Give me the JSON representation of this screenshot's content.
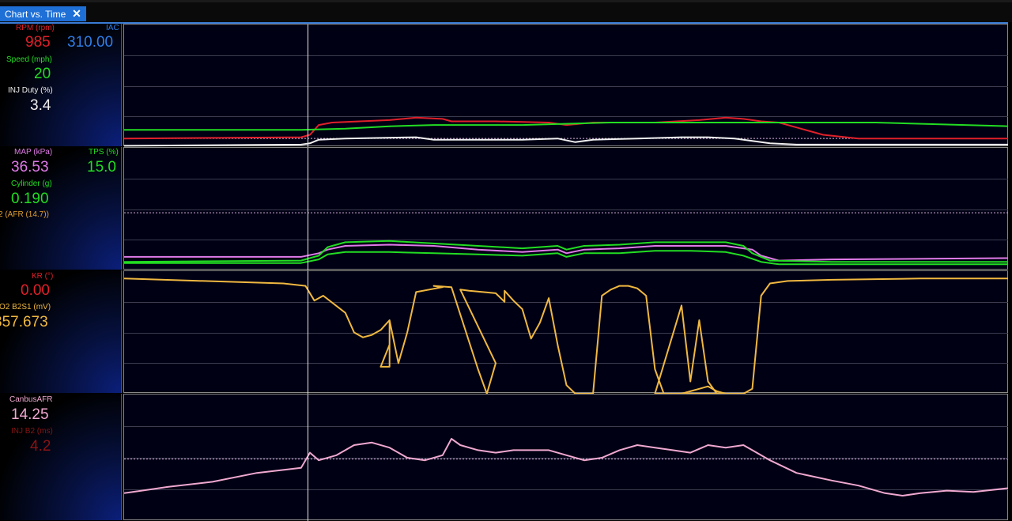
{
  "tab": {
    "title": "Chart vs. Time",
    "close": "✕"
  },
  "cursor_fraction": 0.207,
  "panels": [
    {
      "params": [
        {
          "label": "RPM (rpm)",
          "value": "985",
          "color": "#e0202a"
        },
        {
          "label": "IAC",
          "value": "310.00",
          "color": "#2f7fe8"
        },
        {
          "label": "Speed (mph)",
          "value": "20",
          "color": "#22dd22"
        },
        {
          "label": "INJ Duty (%)",
          "value": "3.4",
          "color": "#f0f0f0"
        }
      ]
    },
    {
      "params": [
        {
          "label": "MAP (kPa)",
          "value": "36.53",
          "color": "#e07ae8"
        },
        {
          "label": "TPS (%)",
          "value": "15.0",
          "color": "#22dd22"
        },
        {
          "label": "Cylinder (g)",
          "value": "0.190",
          "color": "#22dd22"
        },
        {
          "label": "2 (AFR (14.7))",
          "value": "",
          "color": "#e0a030"
        }
      ]
    },
    {
      "params": [
        {
          "label": "KR (°)",
          "value": "0.00",
          "color": "#e0202a"
        },
        {
          "label": "O2 B2S1 (mV)",
          "value": "357.673",
          "color": "#f0b840"
        }
      ]
    },
    {
      "params": [
        {
          "label": "CanbusAFR",
          "value": "14.25",
          "color": "#f0a8d0"
        },
        {
          "label": "INJ B2 (ms)",
          "value": "4.2",
          "color": "#8a1414"
        }
      ]
    }
  ],
  "chart_data": [
    {
      "type": "line",
      "series": [
        {
          "name": "RPM (rpm)",
          "color": "#e0202a",
          "points": [
            [
              0,
              0.93
            ],
            [
              0.2,
              0.92
            ],
            [
              0.21,
              0.9
            ],
            [
              0.22,
              0.82
            ],
            [
              0.235,
              0.8
            ],
            [
              0.3,
              0.78
            ],
            [
              0.33,
              0.76
            ],
            [
              0.36,
              0.77
            ],
            [
              0.37,
              0.79
            ],
            [
              0.42,
              0.79
            ],
            [
              0.48,
              0.8
            ],
            [
              0.5,
              0.82
            ],
            [
              0.53,
              0.8
            ],
            [
              0.6,
              0.8
            ],
            [
              0.65,
              0.78
            ],
            [
              0.68,
              0.76
            ],
            [
              0.7,
              0.77
            ],
            [
              0.72,
              0.79
            ],
            [
              0.74,
              0.8
            ],
            [
              0.76,
              0.84
            ],
            [
              0.79,
              0.9
            ],
            [
              0.83,
              0.93
            ],
            [
              1,
              0.93
            ]
          ]
        },
        {
          "name": "Speed (mph)",
          "color": "#22dd22",
          "points": [
            [
              0,
              0.86
            ],
            [
              0.2,
              0.86
            ],
            [
              0.25,
              0.85
            ],
            [
              0.3,
              0.83
            ],
            [
              0.35,
              0.82
            ],
            [
              0.45,
              0.82
            ],
            [
              0.55,
              0.8
            ],
            [
              0.65,
              0.8
            ],
            [
              0.7,
              0.8
            ],
            [
              0.85,
              0.8
            ],
            [
              1,
              0.83
            ]
          ]
        },
        {
          "name": "INJ Duty (%)",
          "color": "#f0f0f0",
          "points": [
            [
              0,
              0.99
            ],
            [
              0.2,
              0.98
            ],
            [
              0.21,
              0.97
            ],
            [
              0.22,
              0.94
            ],
            [
              0.25,
              0.93
            ],
            [
              0.33,
              0.92
            ],
            [
              0.35,
              0.94
            ],
            [
              0.45,
              0.94
            ],
            [
              0.49,
              0.93
            ],
            [
              0.51,
              0.96
            ],
            [
              0.53,
              0.94
            ],
            [
              0.58,
              0.93
            ],
            [
              0.63,
              0.92
            ],
            [
              0.66,
              0.92
            ],
            [
              0.69,
              0.93
            ],
            [
              0.71,
              0.95
            ],
            [
              0.73,
              0.97
            ],
            [
              0.76,
              0.98
            ],
            [
              1,
              0.98
            ]
          ]
        }
      ],
      "reference_line": 0.93
    },
    {
      "type": "line",
      "series": [
        {
          "name": "MAP (kPa)",
          "color": "#e07ae8",
          "points": [
            [
              0,
              0.89
            ],
            [
              0.2,
              0.89
            ],
            [
              0.22,
              0.86
            ],
            [
              0.23,
              0.83
            ],
            [
              0.25,
              0.8
            ],
            [
              0.3,
              0.79
            ],
            [
              0.35,
              0.8
            ],
            [
              0.4,
              0.83
            ],
            [
              0.45,
              0.85
            ],
            [
              0.49,
              0.83
            ],
            [
              0.5,
              0.86
            ],
            [
              0.52,
              0.83
            ],
            [
              0.56,
              0.82
            ],
            [
              0.6,
              0.8
            ],
            [
              0.64,
              0.8
            ],
            [
              0.68,
              0.8
            ],
            [
              0.71,
              0.83
            ],
            [
              0.72,
              0.88
            ],
            [
              0.74,
              0.92
            ],
            [
              0.8,
              0.91
            ],
            [
              1,
              0.9
            ]
          ]
        },
        {
          "name": "TPS (%)",
          "color": "#22dd22",
          "points": [
            [
              0,
              0.93
            ],
            [
              0.2,
              0.92
            ],
            [
              0.22,
              0.88
            ],
            [
              0.23,
              0.81
            ],
            [
              0.25,
              0.77
            ],
            [
              0.3,
              0.76
            ],
            [
              0.35,
              0.78
            ],
            [
              0.4,
              0.8
            ],
            [
              0.45,
              0.82
            ],
            [
              0.49,
              0.8
            ],
            [
              0.5,
              0.83
            ],
            [
              0.52,
              0.8
            ],
            [
              0.56,
              0.79
            ],
            [
              0.6,
              0.77
            ],
            [
              0.64,
              0.77
            ],
            [
              0.68,
              0.77
            ],
            [
              0.7,
              0.8
            ],
            [
              0.71,
              0.86
            ],
            [
              0.73,
              0.92
            ],
            [
              0.8,
              0.93
            ],
            [
              1,
              0.93
            ]
          ]
        },
        {
          "name": "Cylinder (g)",
          "color": "#22dd22",
          "points": [
            [
              0,
              0.94
            ],
            [
              0.2,
              0.94
            ],
            [
              0.22,
              0.91
            ],
            [
              0.23,
              0.87
            ],
            [
              0.25,
              0.85
            ],
            [
              0.3,
              0.85
            ],
            [
              0.35,
              0.86
            ],
            [
              0.4,
              0.87
            ],
            [
              0.45,
              0.88
            ],
            [
              0.49,
              0.86
            ],
            [
              0.5,
              0.89
            ],
            [
              0.52,
              0.86
            ],
            [
              0.56,
              0.86
            ],
            [
              0.6,
              0.84
            ],
            [
              0.64,
              0.84
            ],
            [
              0.68,
              0.85
            ],
            [
              0.7,
              0.88
            ],
            [
              0.72,
              0.93
            ],
            [
              0.74,
              0.95
            ],
            [
              1,
              0.95
            ]
          ]
        }
      ],
      "reference_line": 0.53
    },
    {
      "type": "line",
      "series": [
        {
          "name": "O2 B2S1 (mV)",
          "color": "#f0b840",
          "points": [
            [
              0,
              0.06
            ],
            [
              0.18,
              0.1
            ],
            [
              0.205,
              0.12
            ],
            [
              0.215,
              0.24
            ],
            [
              0.225,
              0.2
            ],
            [
              0.25,
              0.34
            ],
            [
              0.26,
              0.5
            ],
            [
              0.27,
              0.54
            ],
            [
              0.28,
              0.52
            ],
            [
              0.29,
              0.48
            ],
            [
              0.3,
              0.4
            ],
            [
              0.3,
              0.6
            ],
            [
              0.29,
              0.78
            ],
            [
              0.3,
              0.78
            ],
            [
              0.3,
              0.4
            ],
            [
              0.31,
              0.75
            ],
            [
              0.32,
              0.5
            ],
            [
              0.33,
              0.17
            ],
            [
              0.36,
              0.13
            ],
            [
              0.35,
              0.12
            ],
            [
              0.37,
              0.13
            ],
            [
              0.4,
              0.8
            ],
            [
              0.41,
              1.0
            ],
            [
              0.42,
              0.75
            ],
            [
              0.38,
              0.15
            ],
            [
              0.39,
              0.16
            ],
            [
              0.42,
              0.18
            ],
            [
              0.43,
              0.25
            ],
            [
              0.43,
              0.16
            ],
            [
              0.44,
              0.24
            ],
            [
              0.45,
              0.31
            ],
            [
              0.46,
              0.55
            ],
            [
              0.47,
              0.42
            ],
            [
              0.48,
              0.22
            ],
            [
              0.49,
              0.6
            ],
            [
              0.5,
              0.93
            ],
            [
              0.51,
              1.0
            ],
            [
              0.53,
              1.0
            ],
            [
              0.54,
              0.2
            ],
            [
              0.55,
              0.15
            ],
            [
              0.56,
              0.12
            ],
            [
              0.57,
              0.12
            ],
            [
              0.58,
              0.14
            ],
            [
              0.59,
              0.2
            ],
            [
              0.6,
              0.8
            ],
            [
              0.61,
              1.0
            ],
            [
              0.63,
              1.0
            ],
            [
              0.64,
              0.98
            ],
            [
              0.65,
              0.96
            ],
            [
              0.66,
              0.94
            ],
            [
              0.67,
              0.98
            ],
            [
              0.68,
              1.0
            ],
            [
              0.6,
              1.0
            ],
            [
              0.63,
              0.28
            ],
            [
              0.64,
              0.9
            ],
            [
              0.65,
              0.4
            ],
            [
              0.66,
              0.9
            ],
            [
              0.67,
              1.0
            ],
            [
              0.7,
              1.0
            ],
            [
              0.71,
              0.96
            ],
            [
              0.72,
              0.2
            ],
            [
              0.73,
              0.1
            ],
            [
              0.75,
              0.08
            ],
            [
              0.8,
              0.07
            ],
            [
              0.9,
              0.06
            ],
            [
              1,
              0.06
            ]
          ]
        }
      ]
    },
    {
      "type": "line",
      "series": [
        {
          "name": "CanbusAFR",
          "color": "#f0a8d0",
          "points": [
            [
              0,
              0.78
            ],
            [
              0.02,
              0.76
            ],
            [
              0.05,
              0.73
            ],
            [
              0.1,
              0.69
            ],
            [
              0.15,
              0.62
            ],
            [
              0.2,
              0.58
            ],
            [
              0.21,
              0.46
            ],
            [
              0.22,
              0.52
            ],
            [
              0.24,
              0.48
            ],
            [
              0.26,
              0.4
            ],
            [
              0.28,
              0.38
            ],
            [
              0.3,
              0.42
            ],
            [
              0.32,
              0.5
            ],
            [
              0.34,
              0.52
            ],
            [
              0.36,
              0.48
            ],
            [
              0.37,
              0.35
            ],
            [
              0.38,
              0.4
            ],
            [
              0.4,
              0.44
            ],
            [
              0.42,
              0.46
            ],
            [
              0.44,
              0.44
            ],
            [
              0.46,
              0.44
            ],
            [
              0.48,
              0.44
            ],
            [
              0.5,
              0.48
            ],
            [
              0.52,
              0.52
            ],
            [
              0.54,
              0.5
            ],
            [
              0.56,
              0.44
            ],
            [
              0.58,
              0.4
            ],
            [
              0.6,
              0.42
            ],
            [
              0.62,
              0.44
            ],
            [
              0.64,
              0.46
            ],
            [
              0.66,
              0.4
            ],
            [
              0.68,
              0.42
            ],
            [
              0.7,
              0.4
            ],
            [
              0.71,
              0.44
            ],
            [
              0.73,
              0.52
            ],
            [
              0.76,
              0.62
            ],
            [
              0.8,
              0.68
            ],
            [
              0.83,
              0.72
            ],
            [
              0.86,
              0.78
            ],
            [
              0.88,
              0.8
            ],
            [
              0.9,
              0.78
            ],
            [
              0.93,
              0.76
            ],
            [
              0.96,
              0.77
            ],
            [
              1,
              0.74
            ]
          ]
        }
      ],
      "reference_line": 0.51
    }
  ]
}
